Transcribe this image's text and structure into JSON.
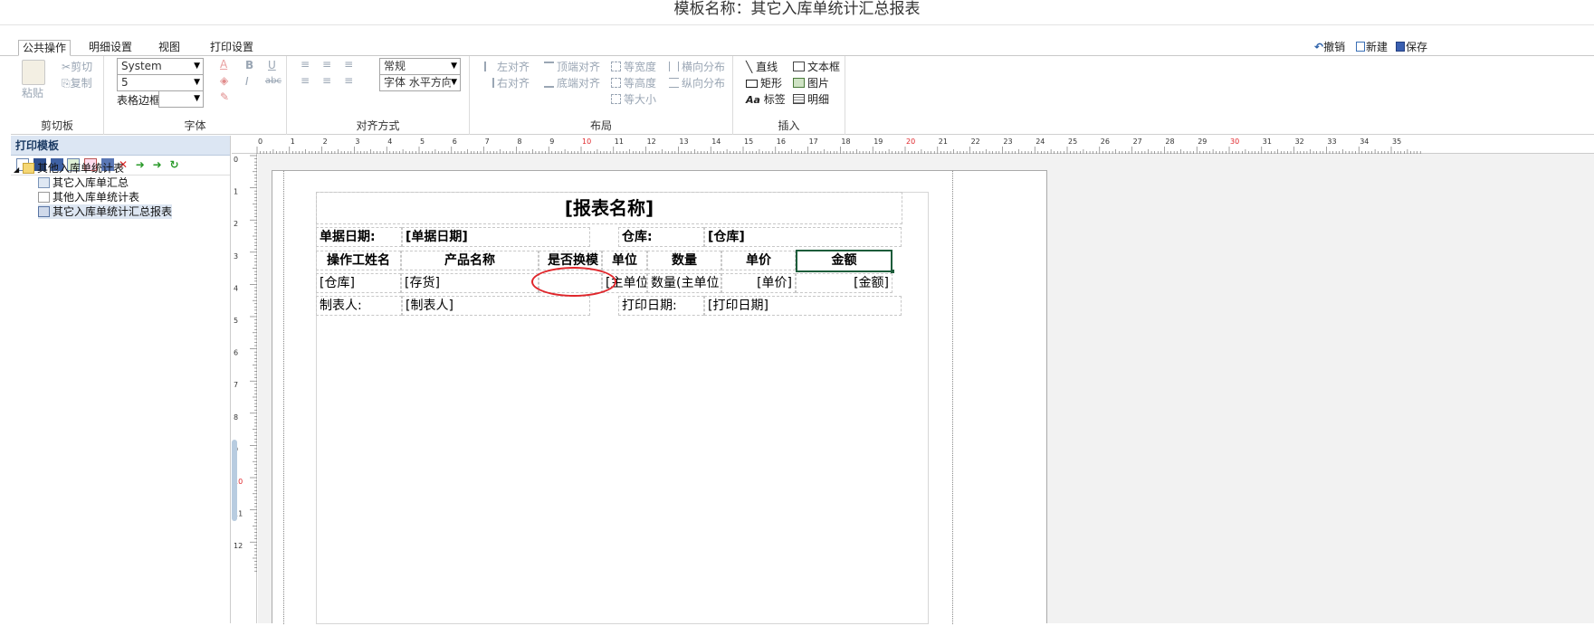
{
  "window": {
    "title": "模板名称：其它入库单统计汇总报表"
  },
  "tabs": [
    "公共操作",
    "明细设置",
    "视图",
    "打印设置"
  ],
  "quick_actions": {
    "undo": "撤销",
    "new": "新建",
    "save": "保存"
  },
  "ribbon": {
    "clipboard": {
      "label": "剪切板",
      "paste": "粘贴",
      "cut": "剪切",
      "copy": "复制"
    },
    "font": {
      "label": "字体",
      "font_family": "System",
      "font_size": "5",
      "table_border": "表格边框",
      "bold": "B",
      "italic": "I",
      "underline": "U",
      "strike": "abc",
      "font_color_glyph": "A"
    },
    "align": {
      "label": "对齐方式",
      "mode": "常规",
      "direction": "字体 水平方向"
    },
    "layout": {
      "label": "布局",
      "left_align": "左对齐",
      "right_align": "右对齐",
      "top_align": "顶端对齐",
      "bottom_align": "底端对齐",
      "equal_width": "等宽度",
      "equal_height": "等高度",
      "equal_size": "等大小",
      "h_distribute": "横向分布",
      "v_distribute": "纵向分布"
    },
    "insert": {
      "label": "插入",
      "line": "直线",
      "textbox": "文本框",
      "rect": "矩形",
      "image": "图片",
      "tag": "标签",
      "detail": "明细"
    }
  },
  "left_panel": {
    "header": "打印模板",
    "tree": {
      "root": "其他入库单统计表",
      "children": [
        "其它入库单汇总",
        "其他入库单统计表",
        "其它入库单统计汇总报表"
      ]
    }
  },
  "rulers": {
    "h_ticks": [
      "0",
      "1",
      "2",
      "3",
      "4",
      "5",
      "6",
      "7",
      "8",
      "9",
      "10",
      "11",
      "12",
      "13",
      "14",
      "15",
      "16",
      "17",
      "18",
      "19",
      "20",
      "21",
      "22",
      "23",
      "24",
      "25",
      "26",
      "27",
      "28",
      "29",
      "30",
      "31",
      "32",
      "33",
      "34",
      "35"
    ],
    "v_ticks": [
      "0",
      "1",
      "2",
      "3",
      "4",
      "5",
      "6",
      "7",
      "8",
      "9",
      "10",
      "11",
      "12"
    ]
  },
  "report": {
    "title": "[报表名称]",
    "bill_date_label": "单据日期:",
    "bill_date_value": "[单据日期]",
    "warehouse_label": "仓库:",
    "warehouse_value": "[仓库]",
    "columns": [
      "操作工姓名",
      "产品名称",
      "是否换模",
      "单位",
      "数量",
      "单价",
      "金额"
    ],
    "detail_row": [
      "[仓库]",
      "[存货]",
      "",
      "[主单位]",
      "数量(主单位)]",
      "[单价]",
      "[金额]"
    ],
    "maker_label": "制表人:",
    "maker_value": "[制表人]",
    "print_date_label": "打印日期:",
    "print_date_value": "[打印日期]"
  },
  "colors": {
    "accent": "#1c5c3a",
    "annotation": "#e0262b",
    "red_tick": "#e0262b"
  }
}
